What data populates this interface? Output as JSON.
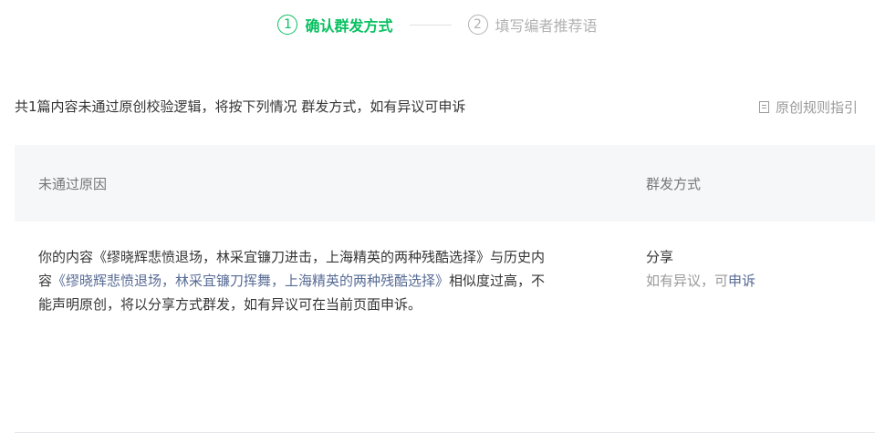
{
  "steps": [
    {
      "num": "1",
      "label": "确认群发方式"
    },
    {
      "num": "2",
      "label": "填写编者推荐语"
    }
  ],
  "summary": "共1篇内容未通过原创校验逻辑，将按下列情况 群发方式，如有异议可申诉",
  "guide_link": "原创规则指引",
  "table": {
    "headers": [
      "未通过原因",
      "群发方式"
    ],
    "rows": [
      {
        "reason_prefix": "你的内容《缪晓辉悲愤退场，林采宜镰刀进击，上海精英的两种残酷选择》与历史内容",
        "reason_link": "《缪晓辉悲愤退场，林采宜镰刀挥舞，上海精英的两种残酷选择》",
        "reason_suffix": "相似度过高，不能声明原创，将以分享方式群发，如有异议可在当前页面申诉。",
        "method": "分享",
        "note_prefix": "如有异议，可",
        "appeal_label": "申诉"
      }
    ]
  },
  "colors": {
    "accent": "#07c160",
    "link": "#576b95"
  }
}
